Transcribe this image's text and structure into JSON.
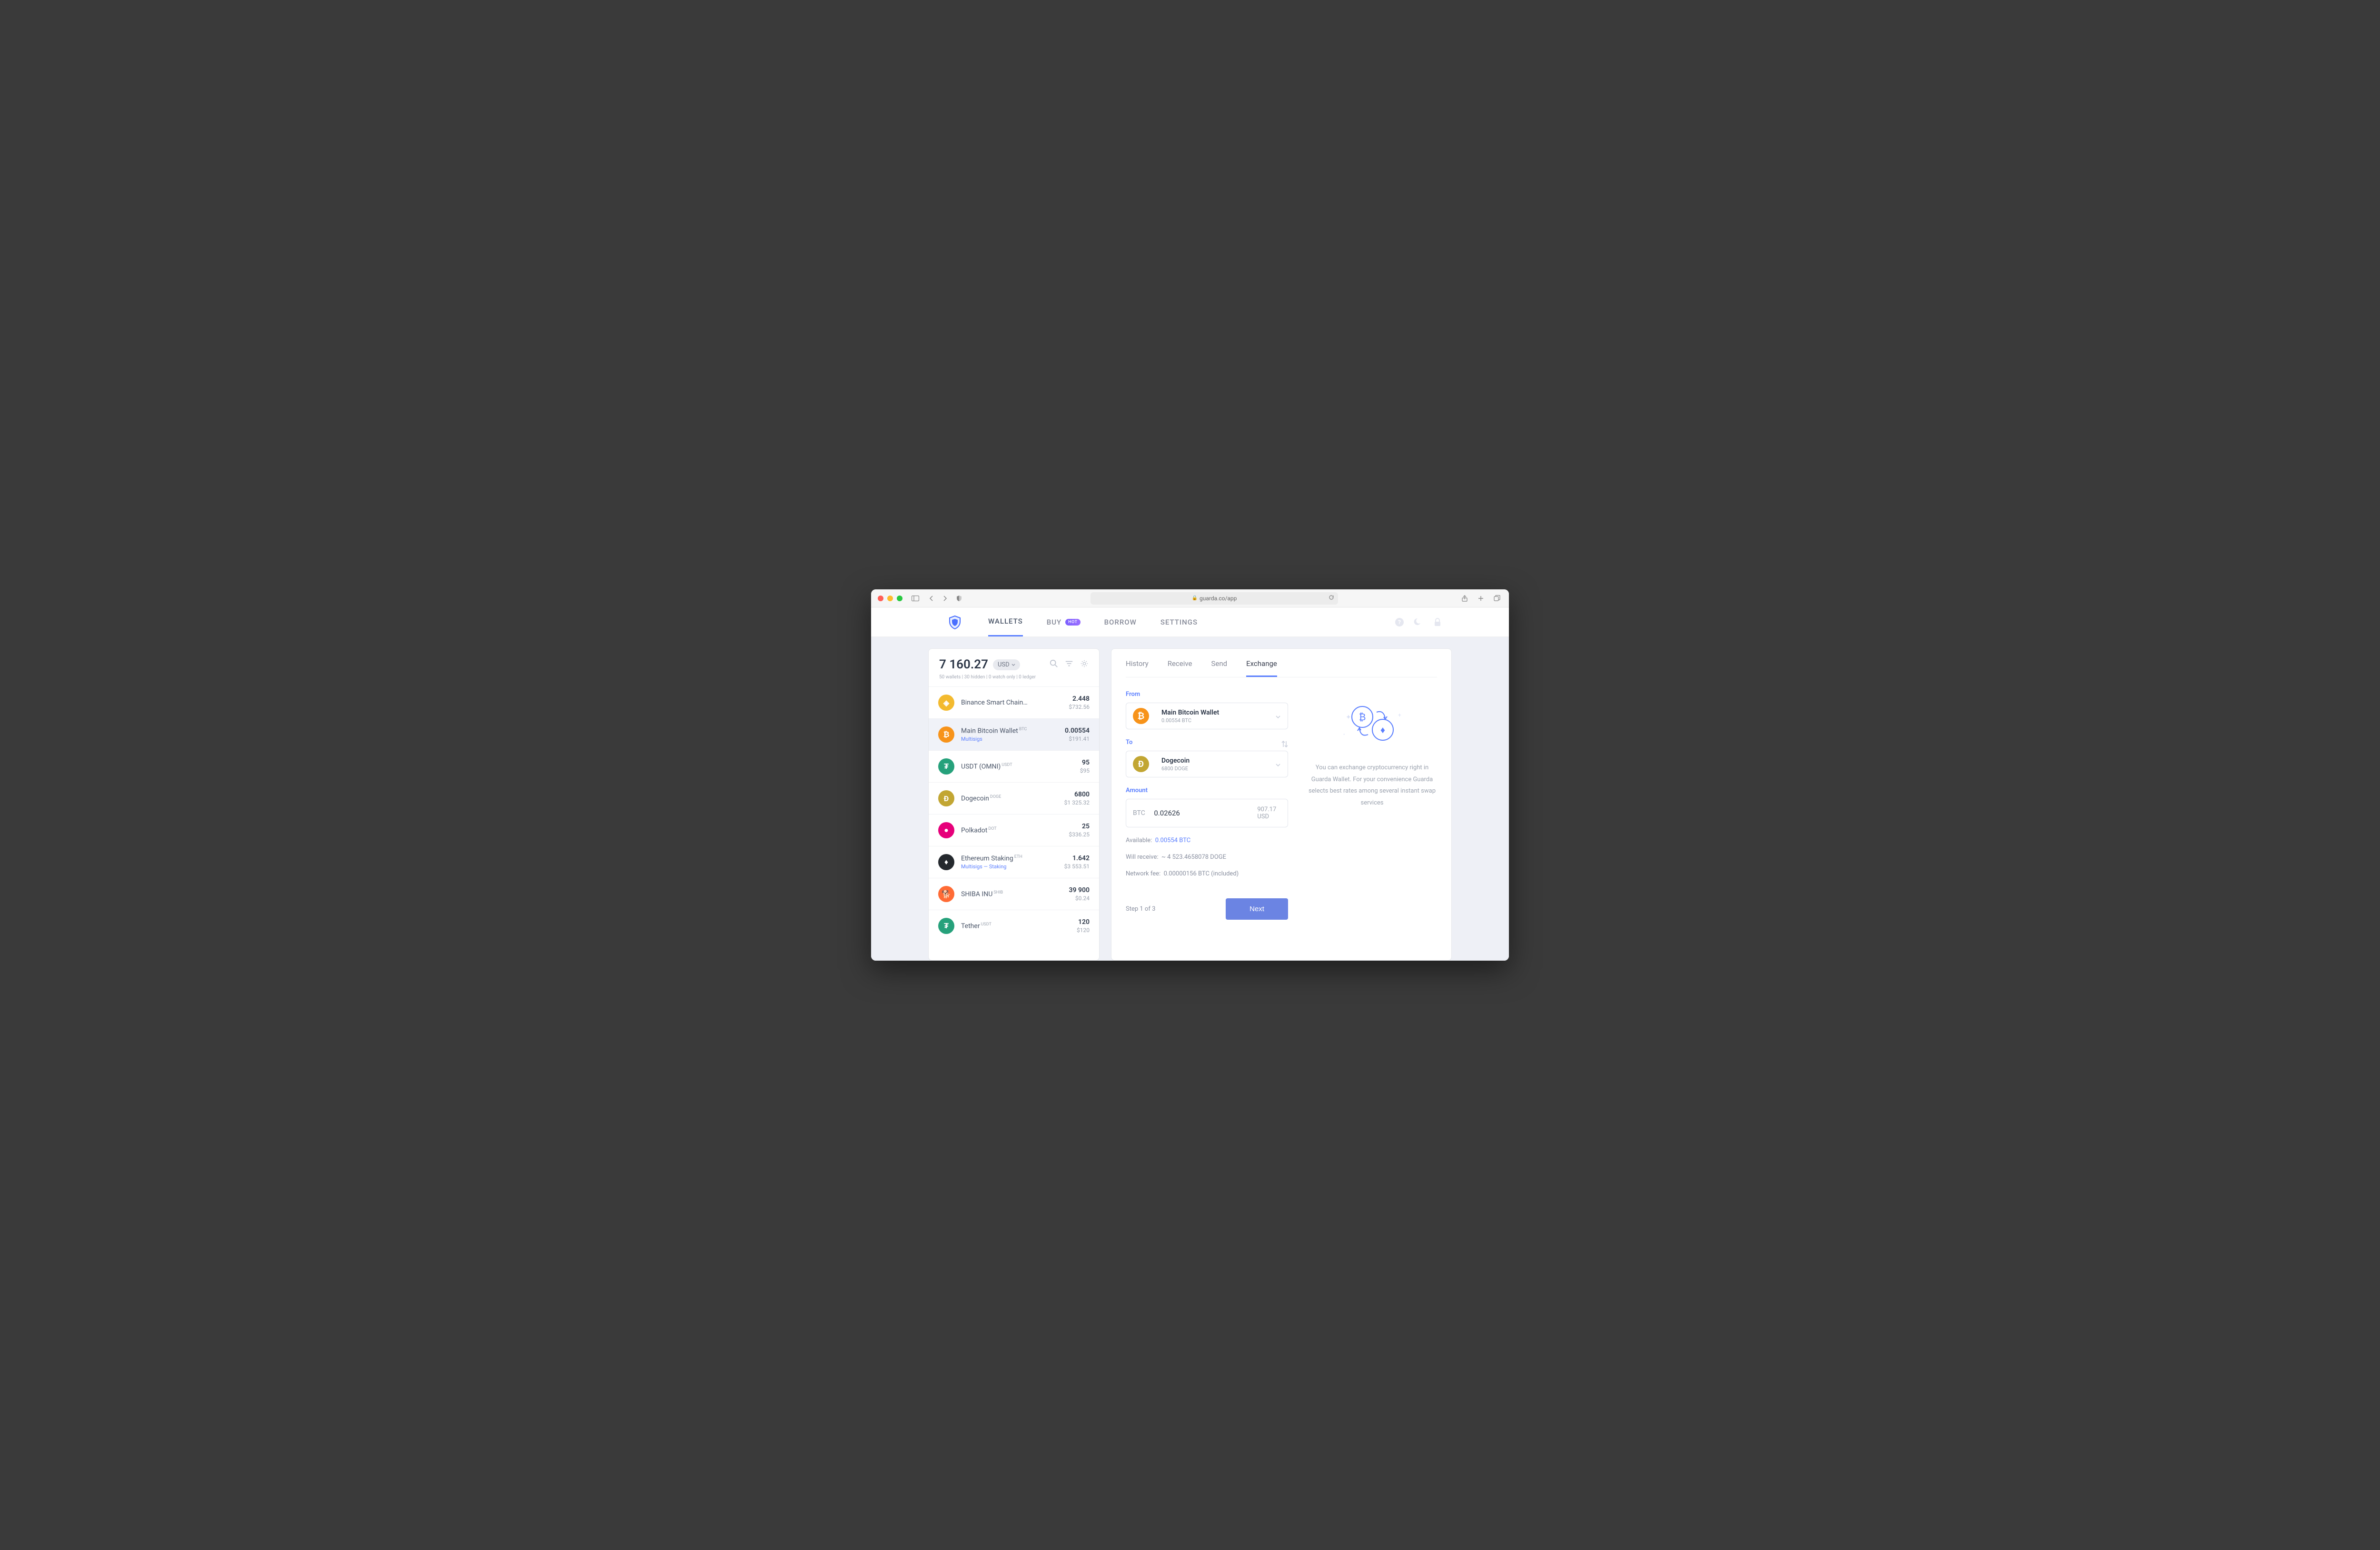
{
  "browser": {
    "url": "guarda.co/app"
  },
  "header": {
    "tabs": [
      "WALLETS",
      "BUY",
      "BORROW",
      "SETTINGS"
    ],
    "active_tab": "WALLETS",
    "buy_badge": "HOT"
  },
  "sidebar": {
    "total": "7 160.27",
    "currency": "USD",
    "summary": "50 wallets | 30 hidden | 0 watch only | 0 ledger",
    "wallets": [
      {
        "name": "Binance Smart Chain…",
        "ticker": "",
        "sublinks": [],
        "amount": "2.448",
        "usd": "$732.56",
        "color": "#f3ba2f",
        "glyph": "◈"
      },
      {
        "name": "Main Bitcoin Wallet",
        "ticker": "BTC",
        "sublinks": [
          "Multisigs"
        ],
        "amount": "0.00554",
        "usd": "$191.41",
        "color": "#f7931a",
        "glyph": "₿",
        "selected": true
      },
      {
        "name": "USDT (OMNI)",
        "ticker": "USDT",
        "sublinks": [],
        "amount": "95",
        "usd": "$95",
        "color": "#26a17b",
        "glyph": "₮"
      },
      {
        "name": "Dogecoin",
        "ticker": "DOGE",
        "sublinks": [],
        "amount": "6800",
        "usd": "$1 325.32",
        "color": "#c2a633",
        "glyph": "Ð"
      },
      {
        "name": "Polkadot",
        "ticker": "DOT",
        "sublinks": [],
        "amount": "25",
        "usd": "$336.25",
        "color": "#e6007a",
        "glyph": "●"
      },
      {
        "name": "Ethereum Staking",
        "ticker": "ETH",
        "sublinks": [
          "Multisigs",
          "Staking"
        ],
        "amount": "1.642",
        "usd": "$3 553.51",
        "color": "#25292e",
        "glyph": "♦"
      },
      {
        "name": "SHIBA INU",
        "ticker": "SHIB",
        "sublinks": [],
        "amount": "39 900",
        "usd": "$0.24",
        "color": "#ff6b35",
        "glyph": "🐕"
      },
      {
        "name": "Tether",
        "ticker": "USDT",
        "sublinks": [],
        "amount": "120",
        "usd": "$120",
        "color": "#26a17b",
        "glyph": "₮"
      }
    ]
  },
  "panel": {
    "tabs": [
      "History",
      "Receive",
      "Send",
      "Exchange"
    ],
    "active_tab": "Exchange",
    "from_label": "From",
    "to_label": "To",
    "amount_label": "Amount",
    "from": {
      "name": "Main Bitcoin Wallet",
      "sub": "0.00554 BTC",
      "color": "#f7931a",
      "glyph": "₿"
    },
    "to": {
      "name": "Dogecoin",
      "sub": "6800 DOGE",
      "color": "#c2a633",
      "glyph": "Ð"
    },
    "amount_currency": "BTC",
    "amount_value": "0.02626",
    "amount_usd": "907.17 USD",
    "available_label": "Available:",
    "available_value": "0.00554 BTC",
    "receive_label": "Will receive:",
    "receive_value": "~ 4 523.4658078 DOGE",
    "fee_label": "Network fee:",
    "fee_value": "0.00000156 BTC (included)",
    "step_text": "Step 1 of 3",
    "next_label": "Next",
    "promo_text": "You can exchange cryptocurrency right in Guarda Wallet. For your convenience Guarda selects best rates among several instant swap services"
  }
}
